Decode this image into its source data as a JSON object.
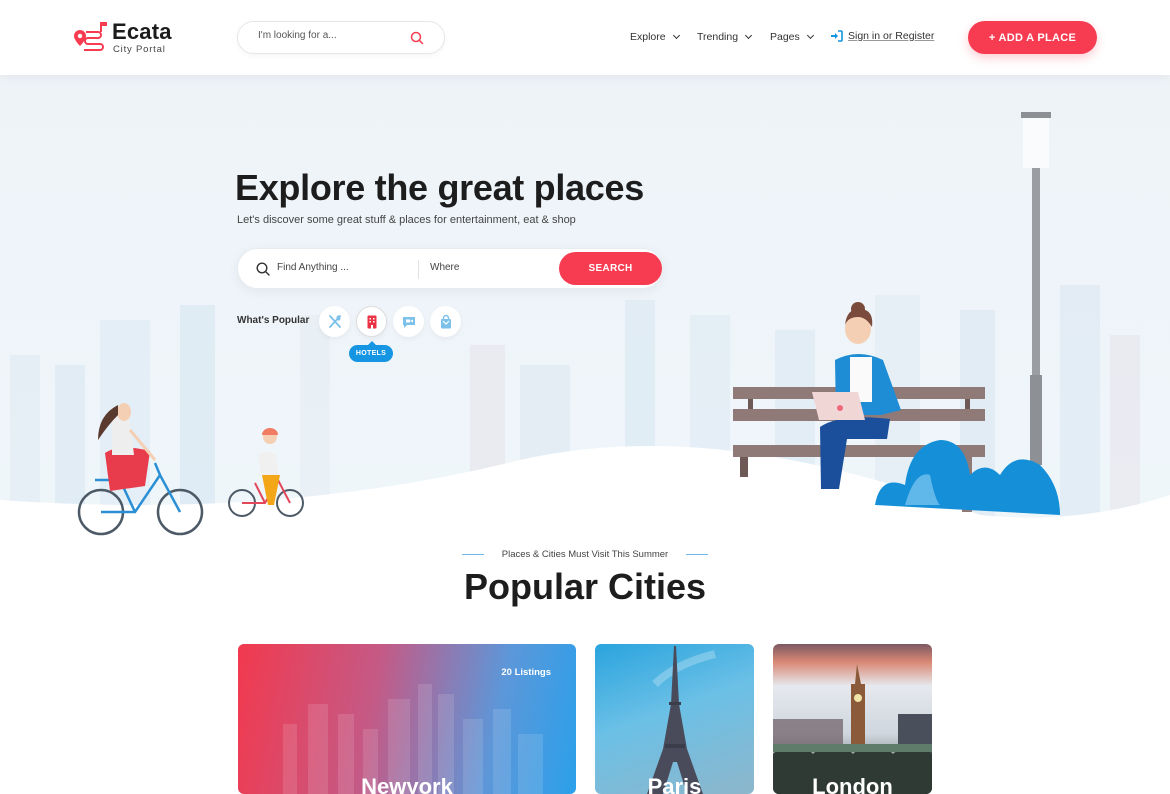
{
  "header": {
    "logo": {
      "title": "Ecata",
      "subtitle": "City Portal"
    },
    "search": {
      "placeholder": "I'm looking for a..."
    },
    "nav": [
      {
        "label": "Explore"
      },
      {
        "label": "Trending"
      },
      {
        "label": "Pages"
      }
    ],
    "signin_label": "Sign in or Register",
    "add_place_label": "+ ADD A PLACE"
  },
  "hero": {
    "title": "Explore the great places",
    "subtitle": "Let's discover some great stuff & places for entertainment, eat  & shop",
    "search": {
      "find_placeholder": "Find Anything ...",
      "where_placeholder": "Where",
      "button_label": "SEARCH"
    },
    "popular": {
      "label": "What's Popular",
      "categories": [
        {
          "icon": "restaurant-icon",
          "name": "Restaurants"
        },
        {
          "icon": "hotel-icon",
          "name": "Hotels",
          "active": true
        },
        {
          "icon": "video-icon",
          "name": "Events"
        },
        {
          "icon": "shopping-bag-icon",
          "name": "Shopping"
        }
      ],
      "tooltip": "HOTELS"
    }
  },
  "section": {
    "subtitle": "Places & Cities Must Visit This Summer",
    "title": "Popular Cities"
  },
  "cities": [
    {
      "name": "Newyork",
      "listings": "20 Listings"
    },
    {
      "name": "Paris"
    },
    {
      "name": "London"
    }
  ],
  "colors": {
    "accent": "#f73c52",
    "secondary": "#1595e2",
    "hero_bg": "#eef4f9"
  }
}
